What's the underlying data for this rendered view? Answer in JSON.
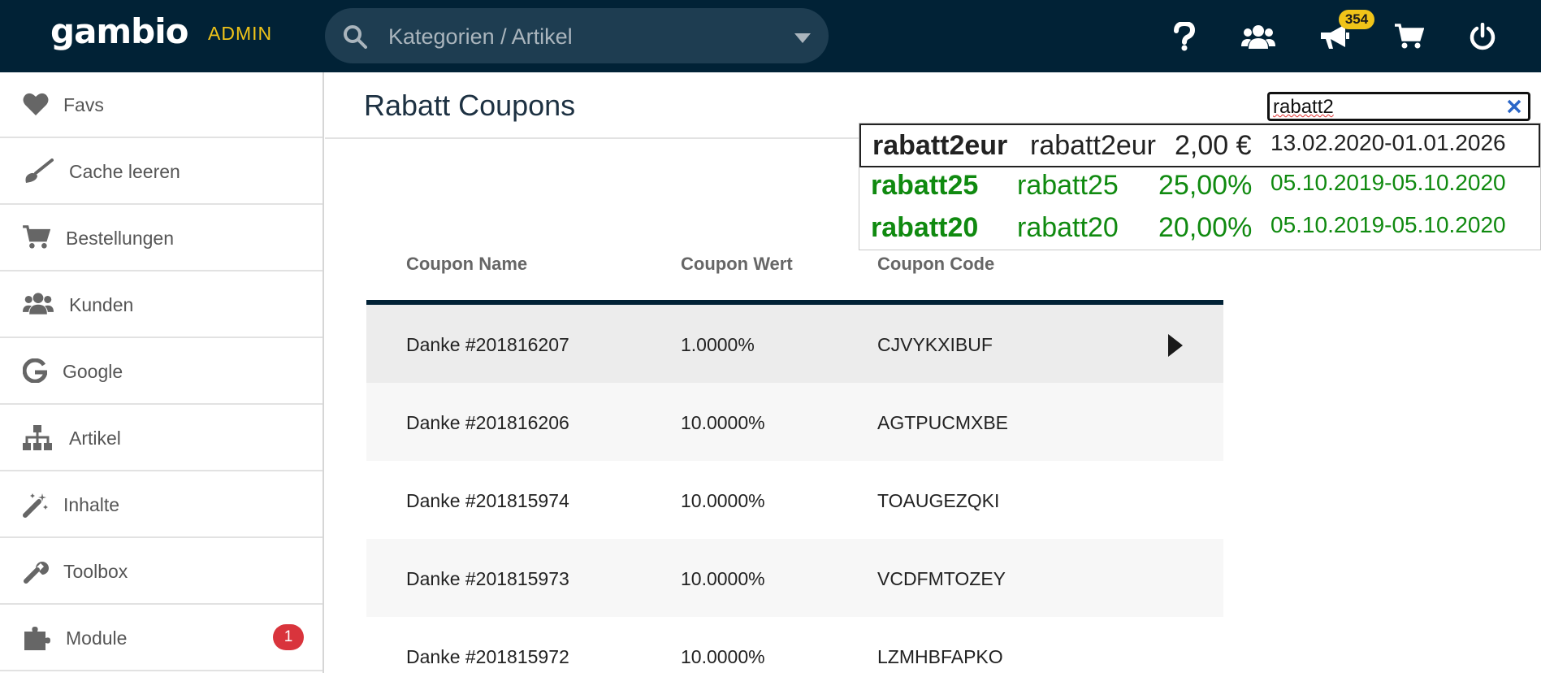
{
  "topbar": {
    "logo": "gambio",
    "admin_label": "ADMIN",
    "search_placeholder": "Kategorien / Artikel",
    "notification_count": "354"
  },
  "sidebar": {
    "items": [
      {
        "label": "Favs",
        "icon": "heart-icon"
      },
      {
        "label": "Cache leeren",
        "icon": "brush-icon"
      },
      {
        "label": "Bestellungen",
        "icon": "cart-icon"
      },
      {
        "label": "Kunden",
        "icon": "users-icon"
      },
      {
        "label": "Google",
        "icon": "google-icon"
      },
      {
        "label": "Artikel",
        "icon": "sitemap-icon"
      },
      {
        "label": "Inhalte",
        "icon": "magic-wand-icon"
      },
      {
        "label": "Toolbox",
        "icon": "wrench-icon"
      },
      {
        "label": "Module",
        "icon": "puzzle-icon",
        "badge": "1"
      }
    ]
  },
  "main": {
    "title": "Rabatt Coupons",
    "filter_value": "rabatt2",
    "suggestions": [
      {
        "name": "rabatt2eur",
        "code": "rabatt2eur",
        "value": "2,00 €",
        "period": "13.02.2020-01.01.2026",
        "color": "#222222"
      },
      {
        "name": "rabatt25",
        "code": "rabatt25",
        "value": "25,00%",
        "period": "05.10.2019-05.10.2020",
        "color": "#108a10"
      },
      {
        "name": "rabatt20",
        "code": "rabatt20",
        "value": "20,00%",
        "period": "05.10.2019-05.10.2020",
        "color": "#108a10"
      }
    ],
    "table": {
      "headers": [
        "Coupon Name",
        "Coupon Wert",
        "Coupon Code"
      ],
      "rows": [
        {
          "name": "Danke #201816207",
          "value": "1.0000%",
          "code": "CJVYKXIBUF"
        },
        {
          "name": "Danke #201816206",
          "value": "10.0000%",
          "code": "AGTPUCMXBE"
        },
        {
          "name": "Danke #201815974",
          "value": "10.0000%",
          "code": "TOAUGEZQKI"
        },
        {
          "name": "Danke #201815973",
          "value": "10.0000%",
          "code": "VCDFMTOZEY"
        },
        {
          "name": "Danke #201815972",
          "value": "10.0000%",
          "code": "LZMHBFAPKO"
        }
      ]
    }
  },
  "colors": {
    "topbar_bg": "#012236",
    "accent_yellow": "#f0c419",
    "badge_red": "#d9343c",
    "success_green": "#108a10"
  }
}
